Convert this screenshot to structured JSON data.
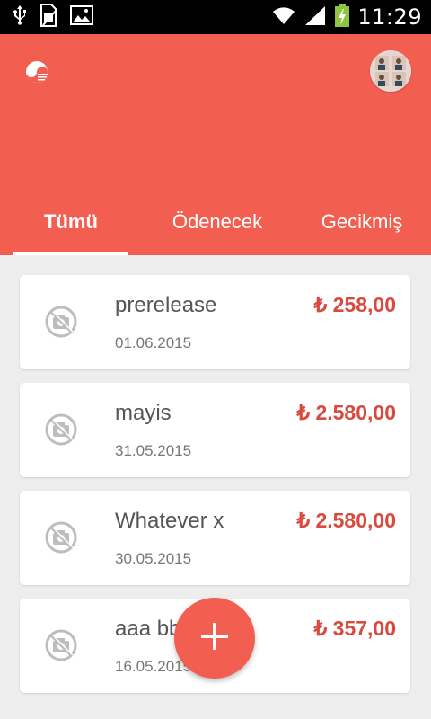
{
  "status_bar": {
    "time": "11:29",
    "icons": [
      "usb-icon",
      "sim-card-icon",
      "image-icon",
      "wifi-icon",
      "signal-icon",
      "battery-charging-icon"
    ]
  },
  "app": {
    "logo": "app-logo-icon",
    "avatar": "user-avatar",
    "accent": "#f25f50",
    "amount_color": "#d84a3e"
  },
  "tabs": [
    {
      "label": "Tümü",
      "active": true
    },
    {
      "label": "Ödenecek",
      "active": false
    },
    {
      "label": "Gecikmiş",
      "active": false
    }
  ],
  "items": [
    {
      "title": "prerelease",
      "date": "01.06.2015",
      "amount": "₺ 258,00"
    },
    {
      "title": "mayis",
      "date": "31.05.2015",
      "amount": "₺ 2.580,00"
    },
    {
      "title": "Whatever x",
      "date": "30.05.2015",
      "amount": "₺ 2.580,00"
    },
    {
      "title": "aaa bb",
      "date": "16.05.2015",
      "amount": "₺ 357,00"
    }
  ],
  "fab": {
    "icon": "plus-icon"
  }
}
